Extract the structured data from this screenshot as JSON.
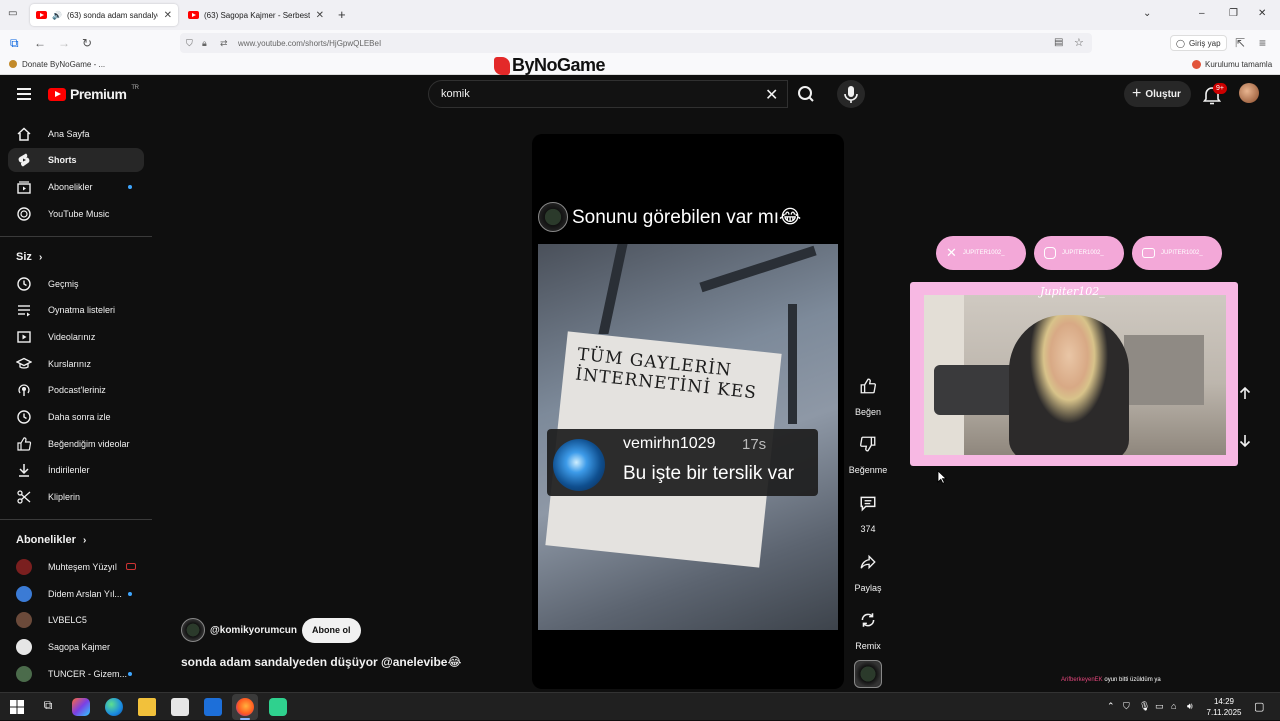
{
  "browser": {
    "tabs": [
      {
        "label": "(63) sonda adam sandalyed",
        "active": true
      },
      {
        "label": "(63) Sagopa Kajmer - Serbest (C",
        "active": false
      }
    ],
    "url": "www.youtube.com/shorts/HjGpwQLEBeI",
    "signin_label": "Giriş yap",
    "bookmark_left": "Donate ByNoGame - ...",
    "bookmark_right": "Kurulumu tamamla",
    "bynogame_banner": "ByNoGame"
  },
  "youtube": {
    "logo_text": "Premium",
    "logo_region": "TR",
    "search_value": "komik",
    "create_label": "Oluştur",
    "notif_badge": "9+",
    "sidebar": {
      "main": [
        {
          "label": "Ana Sayfa",
          "icon": "home-icon"
        },
        {
          "label": "Shorts",
          "icon": "shorts-icon",
          "active": true
        },
        {
          "label": "Abonelikler",
          "icon": "subscriptions-icon",
          "dot": true
        },
        {
          "label": "YouTube Music",
          "icon": "music-icon"
        }
      ],
      "you_header": "Siz",
      "you": [
        {
          "label": "Geçmiş",
          "icon": "history-icon"
        },
        {
          "label": "Oynatma listeleri",
          "icon": "playlist-icon"
        },
        {
          "label": "Videolarınız",
          "icon": "your-videos-icon"
        },
        {
          "label": "Kurslarınız",
          "icon": "courses-icon"
        },
        {
          "label": "Podcast'leriniz",
          "icon": "podcast-icon"
        },
        {
          "label": "Daha sonra izle",
          "icon": "watch-later-icon"
        },
        {
          "label": "Beğendiğim videolar",
          "icon": "liked-icon"
        },
        {
          "label": "İndirilenler",
          "icon": "download-icon"
        },
        {
          "label": "Kliplerin",
          "icon": "clips-icon"
        }
      ],
      "subs_header": "Abonelikler",
      "subs": [
        {
          "label": "Muhteşem Yüzyıl",
          "color": "#7a1f1f",
          "live": true
        },
        {
          "label": "Didem Arslan Yıl...",
          "color": "#3b7bd5",
          "dot": true
        },
        {
          "label": "LVBELC5",
          "color": "#6b4a3a"
        },
        {
          "label": "Sagopa Kajmer",
          "color": "#e6e6e6"
        },
        {
          "label": "TUNCER - Gizem...",
          "color": "#4b6b4b",
          "dot": true
        }
      ]
    },
    "short": {
      "title": "Sonunu görebilen var mı😂",
      "paper_line1": "TÜM GAYLERİN",
      "paper_line2": "İNTERNETİNİ KES",
      "comment_user": "vemirhn1029",
      "comment_time": "17s",
      "comment_text": "Bu işte bir terslik var",
      "channel_handle": "@komikyorumcun",
      "subscribe_label": "Abone ol",
      "description": "sonda adam sandalyeden düşüyor @anelevibe😂"
    },
    "actions": [
      {
        "label": "Beğen",
        "icon": "like-icon"
      },
      {
        "label": "Beğenme",
        "icon": "dislike-icon"
      },
      {
        "label": "374",
        "icon": "comment-icon"
      },
      {
        "label": "Paylaş",
        "icon": "share-icon"
      },
      {
        "label": "Remix",
        "icon": "remix-icon"
      }
    ]
  },
  "overlay": {
    "socials": [
      "JUPITER1002_",
      "JUPITER1002_",
      "JUPITER1002_"
    ],
    "cam_name": "Jupiter102_",
    "ticker_name": "ArifberkeyenEK",
    "ticker_text": "oyun bitti üzüldüm ya"
  },
  "taskbar": {
    "time": "14:29",
    "date": "7.11.2025"
  }
}
